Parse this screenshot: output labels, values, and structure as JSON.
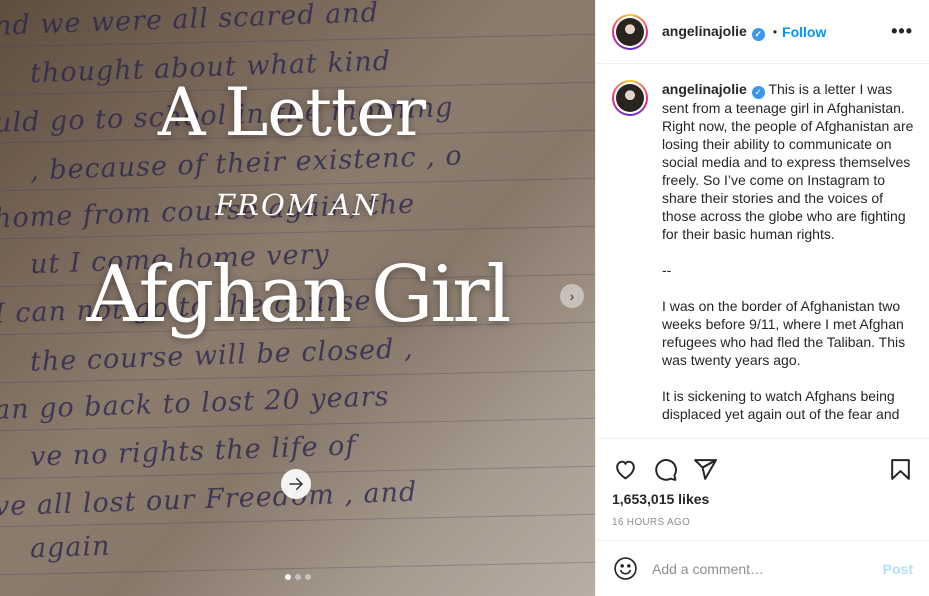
{
  "media": {
    "title_line1": "A Letter",
    "title_line2": "FROM AN",
    "title_line3": "Afghan Girl",
    "handwriting": [
      "nd   we   were   all   scared   and",
      "thought   about   what   kind",
      "uld  go  to  school  in  the  morning",
      ", because   of   their   existenc ,  o",
      "home   from   course   again,   the",
      "ut   I   come   home   very",
      "I   can   not   go   to   the   course",
      "the   course   will   be   closed ,",
      "an   go   back   to   lost   20   years",
      "ve   no   rights   the   life   of",
      "ve   all   lost   our   Freedom ,  and",
      "again"
    ],
    "next_arrow_glyph": "›",
    "carousel_dots": 3,
    "active_dot": 0
  },
  "header": {
    "username": "angelinajolie",
    "separator": "•",
    "follow_label": "Follow",
    "more_glyph": "•••"
  },
  "caption": {
    "username": "angelinajolie",
    "paragraphs": [
      "This is a letter I was sent from a teenage girl in Afghanistan. Right now, the people of Afghanistan are losing their ability to communicate on social media and to express themselves freely. So I’ve come on Instagram to share their stories and the voices of those across the globe who are fighting for their basic human rights.",
      "--",
      "I was on the border of Afghanistan two weeks before 9/11, where I met Afghan refugees who had fled the Taliban. This was twenty years ago.",
      "It is sickening to watch Afghans being displaced yet again out of the fear and"
    ]
  },
  "stats": {
    "likes": "1,653,015 likes",
    "timestamp": "16 HOURS AGO"
  },
  "comment": {
    "placeholder": "Add a comment…",
    "post_label": "Post"
  },
  "colors": {
    "accent": "#0095f6",
    "verified": "#3897f0",
    "muted": "#8e8e8e",
    "post_disabled": "#b2dffc"
  }
}
